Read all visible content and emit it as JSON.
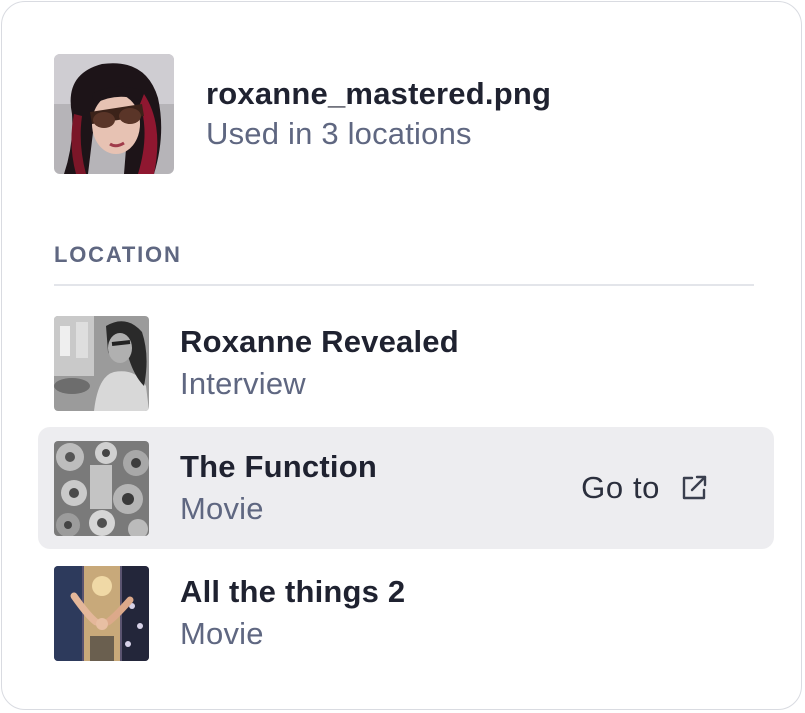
{
  "file": {
    "name": "roxanne_mastered.png",
    "usage": "Used in 3 locations"
  },
  "section": {
    "label": "LOCATION"
  },
  "locations": [
    {
      "title": "Roxanne Revealed",
      "type": "Interview"
    },
    {
      "title": "The Function",
      "type": "Movie",
      "action": "Go to",
      "action_icon": "external-link-icon"
    },
    {
      "title": "All the things 2",
      "type": "Movie"
    }
  ]
}
